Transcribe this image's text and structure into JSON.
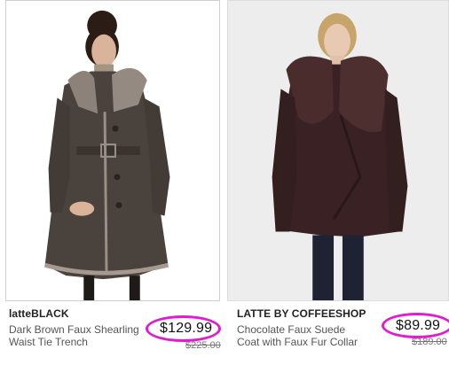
{
  "products": [
    {
      "image_alt": "Model wearing dark brown faux shearling trench coat",
      "brand": "latteBLACK",
      "description": "Dark Brown Faux Shearling Waist Tie Trench",
      "price": "$129.99",
      "original_price": "$225.00"
    },
    {
      "image_alt": "Model wearing chocolate faux suede coat with faux fur collar",
      "brand": "LATTE BY COFFEESHOP",
      "description": "Chocolate Faux Suede Coat with Faux Fur Collar",
      "price": "$89.99",
      "original_price": "$189.00"
    }
  ],
  "colors": {
    "highlight_circle": "#e31bd0",
    "coat_left": "#4a423c",
    "coat_right": "#3a2224"
  }
}
